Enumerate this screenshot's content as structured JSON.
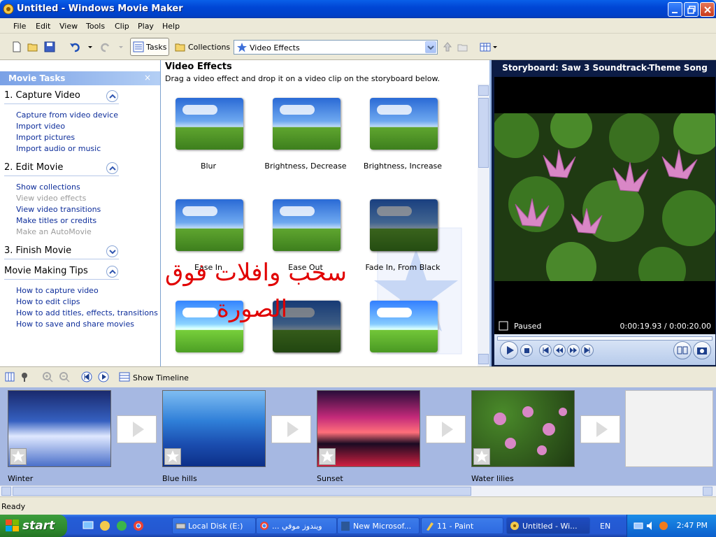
{
  "window": {
    "title": "Untitled - Windows Movie Maker"
  },
  "menu": [
    "File",
    "Edit",
    "View",
    "Tools",
    "Clip",
    "Play",
    "Help"
  ],
  "toolbar": {
    "tasks_label": "Tasks",
    "collections_label": "Collections",
    "collection_selected": "Video Effects"
  },
  "task_pane": {
    "title": "Movie Tasks",
    "close": "×",
    "sections": [
      {
        "title": "1. Capture Video",
        "expanded": true,
        "links": [
          {
            "label": "Capture from video device",
            "enabled": true
          },
          {
            "label": "Import video",
            "enabled": true
          },
          {
            "label": "Import pictures",
            "enabled": true
          },
          {
            "label": "Import audio or music",
            "enabled": true
          }
        ]
      },
      {
        "title": "2. Edit Movie",
        "expanded": true,
        "links": [
          {
            "label": "Show collections",
            "enabled": true
          },
          {
            "label": "View video effects",
            "enabled": false
          },
          {
            "label": "View video transitions",
            "enabled": true
          },
          {
            "label": "Make titles or credits",
            "enabled": true
          },
          {
            "label": "Make an AutoMovie",
            "enabled": false
          }
        ]
      },
      {
        "title": "3. Finish Movie",
        "expanded": false,
        "links": []
      },
      {
        "title": "Movie Making Tips",
        "expanded": true,
        "links": [
          {
            "label": "How to capture video",
            "enabled": true
          },
          {
            "label": "How to edit clips",
            "enabled": true
          },
          {
            "label": "How to add titles, effects, transitions",
            "enabled": true
          },
          {
            "label": "How to save and share movies",
            "enabled": true
          }
        ]
      }
    ]
  },
  "effects_panel": {
    "heading": "Video Effects",
    "instructions": "Drag a video effect and drop it on a video clip on the storyboard below.",
    "effects": [
      "Blur",
      "Brightness, Decrease",
      "Brightness, Increase",
      "Ease In",
      "Ease Out",
      "Fade In, From Black"
    ],
    "overlay_line1": "سحب وافلات فوق",
    "overlay_line2": "الصورة"
  },
  "monitor": {
    "title": "Storyboard: Saw 3 Soundtrack-Theme Song",
    "state": "Paused",
    "time": "0:00:19.93 / 0:00:20.00"
  },
  "storyboard": {
    "show_timeline_label": "Show Timeline",
    "clips": [
      "Winter",
      "Blue hills",
      "Sunset",
      "Water lilies"
    ]
  },
  "status_bar": {
    "text": "Ready"
  },
  "taskbar": {
    "start_label": "start",
    "tasks": [
      {
        "label": "Local Disk (E:)",
        "active": false
      },
      {
        "label": "... ويندوز موفي",
        "active": false
      },
      {
        "label": "New Microsof...",
        "active": false
      },
      {
        "label": "11 - Paint",
        "active": false
      },
      {
        "label": "Untitled - Wi...",
        "active": true
      }
    ],
    "language": "EN",
    "clock": "2:47 PM"
  }
}
